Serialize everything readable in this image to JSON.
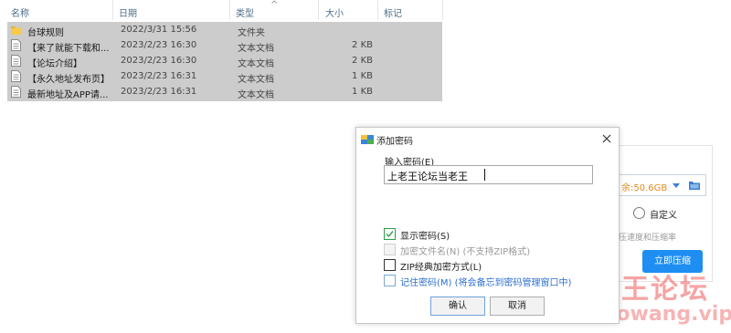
{
  "explorer": {
    "columns": {
      "name": "名称",
      "date": "日期",
      "type": "类型",
      "size": "大小",
      "tags": "标记"
    },
    "sort_indicator": "^",
    "rows": [
      {
        "icon": "folder-icon",
        "name": "台球规则",
        "date": "2022/3/31 15:56",
        "type": "文件夹",
        "size": ""
      },
      {
        "icon": "text-file-icon",
        "name": "【来了就能下载和...",
        "date": "2023/2/23 16:30",
        "type": "文本文档",
        "size": "2 KB"
      },
      {
        "icon": "text-file-icon",
        "name": "【论坛介绍】",
        "date": "2023/2/23 16:30",
        "type": "文本文档",
        "size": "2 KB"
      },
      {
        "icon": "text-file-icon",
        "name": "【永久地址发布页】",
        "date": "2023/2/23 16:31",
        "type": "文本文档",
        "size": "1 KB"
      },
      {
        "icon": "text-file-icon",
        "name": "最新地址及APP请...",
        "date": "2023/2/23 16:31",
        "type": "文本文档",
        "size": "1 KB"
      }
    ]
  },
  "background_window": {
    "free_space": "余:50.6GB",
    "custom_label": "自定义",
    "note": "压速度和压缩率",
    "compress_button": "立即压缩"
  },
  "dialog": {
    "title": "添加密码",
    "password_label": "输入密码(E)",
    "password_value": "上老王论坛当老王",
    "options": {
      "show_password": "显示密码(S)",
      "encrypt_filenames": "加密文件名(N) (不支持ZIP格式)",
      "zip_classic": "ZIP经典加密方式(L)",
      "remember_password": "记住密码(M) (将会备忘到密码管理窗口中)"
    },
    "ok_button": "确认",
    "cancel_button": "取消"
  },
  "watermark": {
    "cn": "老王论坛",
    "en": "laowang.vip"
  },
  "colors": {
    "selection": "#cccccc",
    "accent": "#1e8ef2",
    "link": "#2d6fd0",
    "watermark": "#ef5a5a"
  }
}
